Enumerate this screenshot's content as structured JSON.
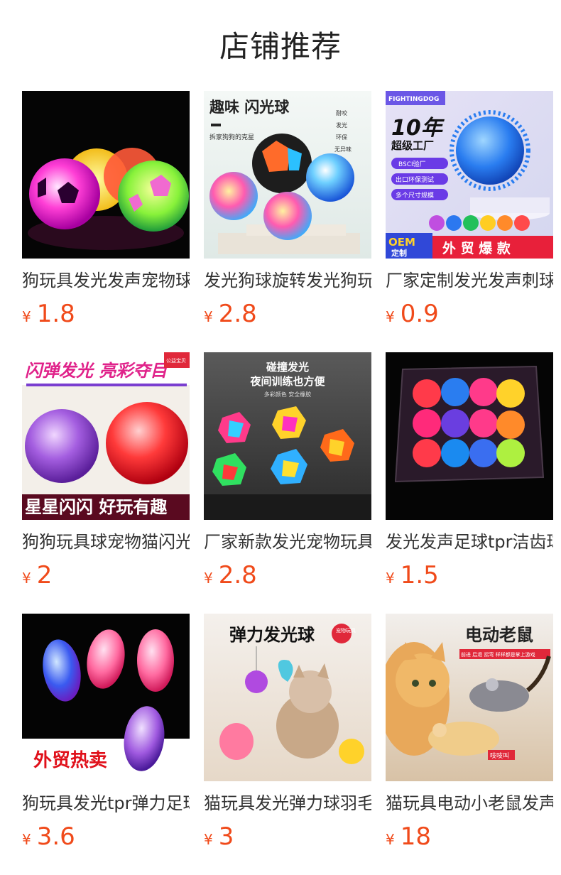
{
  "section": {
    "title": "店铺推荐"
  },
  "products": [
    {
      "title": "狗玩具发光发声宠物球",
      "currency": "¥",
      "price": "1.8",
      "image_texts": []
    },
    {
      "title": "发光狗球旋转发光狗玩具",
      "currency": "¥",
      "price": "2.8",
      "image_texts": [
        "趣味 闪光球",
        "拆家狗狗的克星",
        "耐咬",
        "发光",
        "环保",
        "无异味"
      ]
    },
    {
      "title": "厂家定制发光发声刺球",
      "currency": "¥",
      "price": "0.9",
      "image_texts": [
        "FIGHTINGDOG",
        "10年",
        "超级工厂",
        "BSCI验厂",
        "出口环保测试",
        "多个尺寸规模",
        "OEM",
        "定制",
        "外 贸 爆 款"
      ]
    },
    {
      "title": "狗狗玩具球宠物猫闪光球",
      "currency": "¥",
      "price": "2",
      "image_texts": [
        "闪弹发光 亮彩夺目",
        "公益宝贝",
        "星星闪闪 好玩有趣"
      ]
    },
    {
      "title": "厂家新款发光宠物玩具球",
      "currency": "¥",
      "price": "2.8",
      "image_texts": [
        "碰撞发光",
        "夜间训练也方便",
        "多彩颜色 安全橡胶"
      ]
    },
    {
      "title": "发光发声足球tpr洁齿球",
      "currency": "¥",
      "price": "1.5",
      "image_texts": []
    },
    {
      "title": "狗玩具发光tpr弹力足球",
      "currency": "¥",
      "price": "3.6",
      "image_texts": [
        "外贸热卖"
      ]
    },
    {
      "title": "猫玩具发光弹力球羽毛",
      "currency": "¥",
      "price": "3",
      "image_texts": [
        "弹力发光球",
        "宠物玩具"
      ]
    },
    {
      "title": "猫玩具电动小老鼠发声",
      "currency": "¥",
      "price": "18",
      "image_texts": [
        "电动老鼠",
        "前进 后退 拐弯 样样都是掌上游戏",
        "吱吱叫"
      ]
    }
  ],
  "colors": {
    "price": "#f04a1a",
    "title_text": "#333333",
    "background": "#ffffff"
  }
}
